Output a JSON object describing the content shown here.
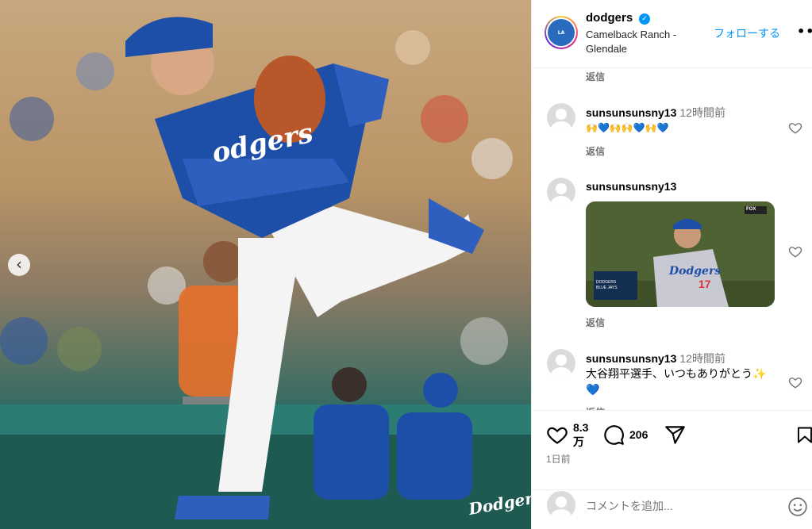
{
  "post": {
    "username": "dodgers",
    "location": "Camelback Ranch - Glendale",
    "follow_label": "フォローする",
    "more_label": "•••",
    "photo_watermark": "Dodgers"
  },
  "comments": [
    {
      "reply_label": "返信"
    },
    {
      "username": "sunsunsunsny13",
      "time": "12時間前",
      "text": "🙌💙🙌🙌💙🙌💙",
      "reply_label": "返信"
    },
    {
      "username": "sunsunsunsny13",
      "gif_label": "Dodgers",
      "gif_number": "17",
      "reply_label": "返信"
    },
    {
      "username": "sunsunsunsny13",
      "time": "12時間前",
      "text": "大谷翔平選手、いつもありがとう✨💙",
      "reply_label": "返信"
    }
  ],
  "gif_scoreboard": {
    "team1": "DODGERS",
    "team2": "BLUE JAYS",
    "network": "FOX"
  },
  "actions": {
    "likes": "8.3万",
    "comments_count": "206",
    "date": "1日前"
  },
  "add_comment": {
    "placeholder": "コメントを追加..."
  },
  "colors": {
    "link_blue": "#0095f6",
    "dodger_blue": "#1e4fa8",
    "muted": "#737373"
  },
  "icons": [
    "verified-icon",
    "heart-icon",
    "comment-icon",
    "share-icon",
    "bookmark-icon",
    "emoji-icon",
    "prev-arrow-icon"
  ]
}
